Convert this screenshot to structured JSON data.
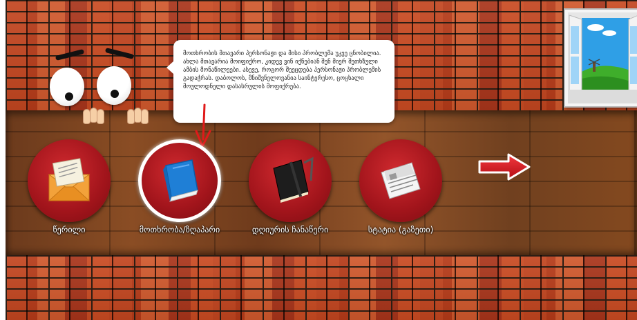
{
  "speech_bubble": {
    "text": "მოთხრობის მთავარი პერსონაჟი და მისი პრობლემა უკვე ცნობილია. ახლა მთავარია მოიფიქრო, კიდევ ვინ იქნებიან შენ მიერ შეთხზული ამბის მონაწილეები. ასევე, როგორ შეეცდება პერსონაჟი პრობლემის გადაჭრას. დაბოლოს, მნიშვნელოვანია საინტერესო, ცოცხალი მოულოდნელი დასასრულის მოფიქრება."
  },
  "options": [
    {
      "label": "წერილი",
      "icon": "envelope-letter-icon",
      "selected": false
    },
    {
      "label": "მოთხრობა/ზღაპარი",
      "icon": "blue-book-icon",
      "selected": true
    },
    {
      "label": "დღიურის ჩანაწერი",
      "icon": "black-notebook-icon",
      "selected": false
    },
    {
      "label": "სტატია (გაზეთი)",
      "icon": "newspaper-icon",
      "selected": false
    }
  ],
  "next_arrow": {
    "icon": "right-arrow-icon"
  },
  "colors": {
    "option_circle": "#a1141b",
    "selection_ring": "#ffffff",
    "arrow_red": "#d3141b",
    "pointer_arrow": "#e01a1a"
  }
}
